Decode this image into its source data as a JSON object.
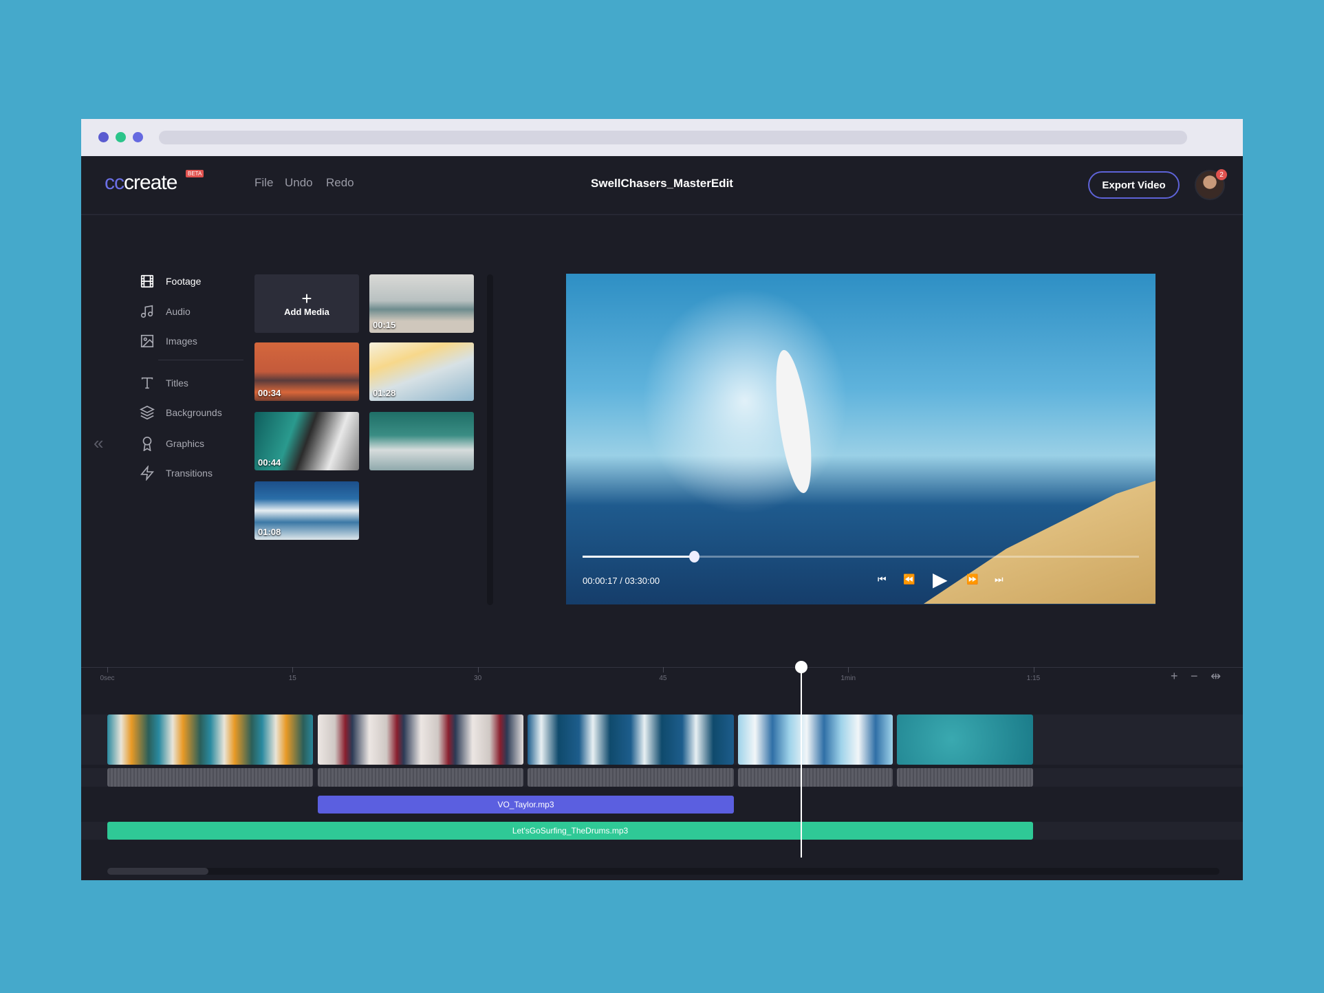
{
  "app": {
    "logo_prefix": "cc",
    "logo_suffix": "create",
    "beta": "BETA",
    "menu": [
      "File",
      "Undo",
      "Redo"
    ],
    "project_title": "SwellChasers_MasterEdit",
    "export_label": "Export Video",
    "notification_count": "2"
  },
  "sidebar": {
    "items": [
      {
        "label": "Footage",
        "icon": "film-icon"
      },
      {
        "label": "Audio",
        "icon": "music-note-icon"
      },
      {
        "label": "Images",
        "icon": "image-icon"
      },
      {
        "label": "Titles",
        "icon": "text-icon"
      },
      {
        "label": "Backgrounds",
        "icon": "layers-icon"
      },
      {
        "label": "Graphics",
        "icon": "award-icon"
      },
      {
        "label": "Transitions",
        "icon": "lightning-icon"
      }
    ],
    "collapse": "«"
  },
  "media": {
    "add_label": "Add Media",
    "add_icon": "+",
    "items": [
      {
        "duration": "00:15"
      },
      {
        "duration": "00:34"
      },
      {
        "duration": "01:28"
      },
      {
        "duration": "00:44"
      },
      {
        "duration": ""
      },
      {
        "duration": "01:08"
      }
    ]
  },
  "player": {
    "time": "00:00:17 / 03:30:00",
    "progress": 0.2
  },
  "timeline": {
    "ticks": [
      "0sec",
      "15",
      "30",
      "45",
      "1min",
      "1:15"
    ],
    "zoom_in": "+",
    "zoom_out": "−",
    "fit": "⇹",
    "voiceover": "VO_Taylor.mp3",
    "music": "Let'sGoSurfing_TheDrums.mp3"
  },
  "colors": {
    "accent": "#5e63d8",
    "music": "#2fc996",
    "voice": "#5b5fe0",
    "bg": "#45a9cb"
  }
}
